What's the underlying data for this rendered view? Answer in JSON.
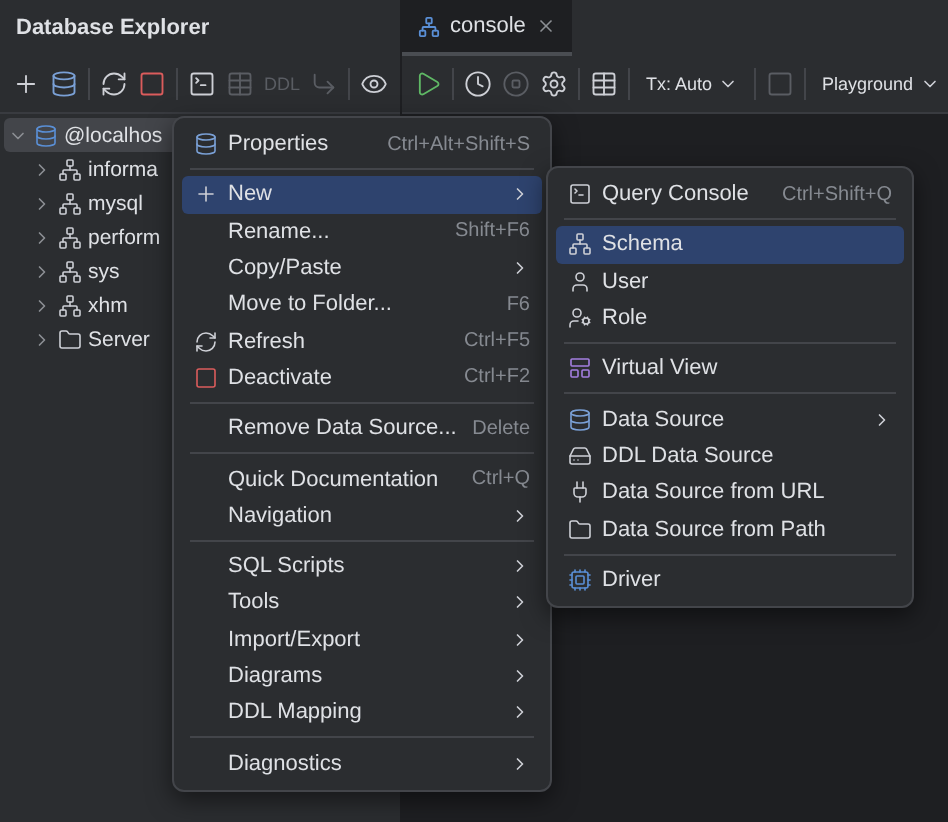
{
  "explorer": {
    "title": "Database Explorer",
    "toolbar": [
      {
        "kind": "button",
        "disabled": false
      },
      {
        "kind": "button",
        "disabled": false
      },
      {
        "kind": "separator"
      },
      {
        "kind": "button",
        "disabled": false
      },
      {
        "kind": "button",
        "disabled": false
      },
      {
        "kind": "separator"
      },
      {
        "kind": "button",
        "disabled": false
      },
      {
        "kind": "button",
        "disabled": true
      },
      {
        "kind": "text",
        "label": "DDL",
        "disabled": true
      },
      {
        "kind": "button",
        "disabled": true
      },
      {
        "kind": "separator"
      },
      {
        "kind": "button",
        "disabled": false
      }
    ],
    "tree": [
      {
        "label": "@localhos",
        "kind": "server",
        "expanded": true,
        "selected": true,
        "children": [
          {
            "label": "informa",
            "kind": "schema",
            "expanded": false,
            "selected": false
          },
          {
            "label": "mysql",
            "kind": "schema",
            "expanded": false,
            "selected": false
          },
          {
            "label": "perform",
            "kind": "schema",
            "expanded": false,
            "selected": false
          },
          {
            "label": "sys",
            "kind": "schema",
            "expanded": false,
            "selected": false
          },
          {
            "label": "xhm",
            "kind": "schema",
            "expanded": false,
            "selected": false
          },
          {
            "label": "Server",
            "kind": "folder",
            "expanded": false,
            "selected": false
          }
        ]
      }
    ]
  },
  "editor": {
    "tabs": [
      {
        "label": "console",
        "selected": true
      }
    ],
    "toolbar": [
      {
        "kind": "button",
        "disabled": false
      },
      {
        "kind": "separator"
      },
      {
        "kind": "button",
        "disabled": false
      },
      {
        "kind": "button",
        "disabled": true
      },
      {
        "kind": "button",
        "disabled": false
      },
      {
        "kind": "separator"
      },
      {
        "kind": "button",
        "disabled": false
      },
      {
        "kind": "separator"
      },
      {
        "kind": "dropdown",
        "label": "Tx: Auto"
      },
      {
        "kind": "separator"
      },
      {
        "kind": "button",
        "disabled": true
      },
      {
        "kind": "separator"
      },
      {
        "kind": "dropdown",
        "label": "Playground"
      }
    ]
  },
  "context_menu": [
    {
      "kind": "item",
      "label": "Properties",
      "shortcut": "Ctrl+Alt+Shift+S",
      "submenu": false,
      "selected": false
    },
    {
      "kind": "separator"
    },
    {
      "kind": "item",
      "label": "New",
      "submenu": true,
      "selected": true
    },
    {
      "kind": "item",
      "label": "Rename...",
      "shortcut": "Shift+F6",
      "submenu": false,
      "selected": false
    },
    {
      "kind": "item",
      "label": "Copy/Paste",
      "submenu": true,
      "selected": false
    },
    {
      "kind": "item",
      "label": "Move to Folder...",
      "shortcut": "F6",
      "submenu": false,
      "selected": false
    },
    {
      "kind": "item",
      "label": "Refresh",
      "shortcut": "Ctrl+F5",
      "submenu": false,
      "selected": false
    },
    {
      "kind": "item",
      "label": "Deactivate",
      "shortcut": "Ctrl+F2",
      "submenu": false,
      "selected": false
    },
    {
      "kind": "separator"
    },
    {
      "kind": "item",
      "label": "Remove Data Source...",
      "shortcut": "Delete",
      "submenu": false,
      "selected": false
    },
    {
      "kind": "separator"
    },
    {
      "kind": "item",
      "label": "Quick Documentation",
      "shortcut": "Ctrl+Q",
      "submenu": false,
      "selected": false
    },
    {
      "kind": "item",
      "label": "Navigation",
      "submenu": true,
      "selected": false
    },
    {
      "kind": "separator"
    },
    {
      "kind": "item",
      "label": "SQL Scripts",
      "submenu": true,
      "selected": false
    },
    {
      "kind": "item",
      "label": "Tools",
      "submenu": true,
      "selected": false
    },
    {
      "kind": "item",
      "label": "Import/Export",
      "submenu": true,
      "selected": false
    },
    {
      "kind": "item",
      "label": "Diagrams",
      "submenu": true,
      "selected": false
    },
    {
      "kind": "item",
      "label": "DDL Mapping",
      "submenu": true,
      "selected": false
    },
    {
      "kind": "separator"
    },
    {
      "kind": "item",
      "label": "Diagnostics",
      "submenu": true,
      "selected": false
    }
  ],
  "submenu": [
    {
      "kind": "item",
      "label": "Query Console",
      "shortcut": "Ctrl+Shift+Q",
      "submenu": false,
      "selected": false
    },
    {
      "kind": "separator"
    },
    {
      "kind": "item",
      "label": "Schema",
      "submenu": false,
      "selected": true
    },
    {
      "kind": "item",
      "label": "User",
      "submenu": false,
      "selected": false
    },
    {
      "kind": "item",
      "label": "Role",
      "submenu": false,
      "selected": false
    },
    {
      "kind": "separator"
    },
    {
      "kind": "item",
      "label": "Virtual View",
      "submenu": false,
      "selected": false
    },
    {
      "kind": "separator"
    },
    {
      "kind": "item",
      "label": "Data Source",
      "submenu": true,
      "selected": false
    },
    {
      "kind": "item",
      "label": "DDL Data Source",
      "submenu": false,
      "selected": false
    },
    {
      "kind": "item",
      "label": "Data Source from URL",
      "submenu": false,
      "selected": false
    },
    {
      "kind": "item",
      "label": "Data Source from Path",
      "submenu": false,
      "selected": false
    },
    {
      "kind": "separator"
    },
    {
      "kind": "item",
      "label": "Driver",
      "submenu": false,
      "selected": false
    }
  ]
}
